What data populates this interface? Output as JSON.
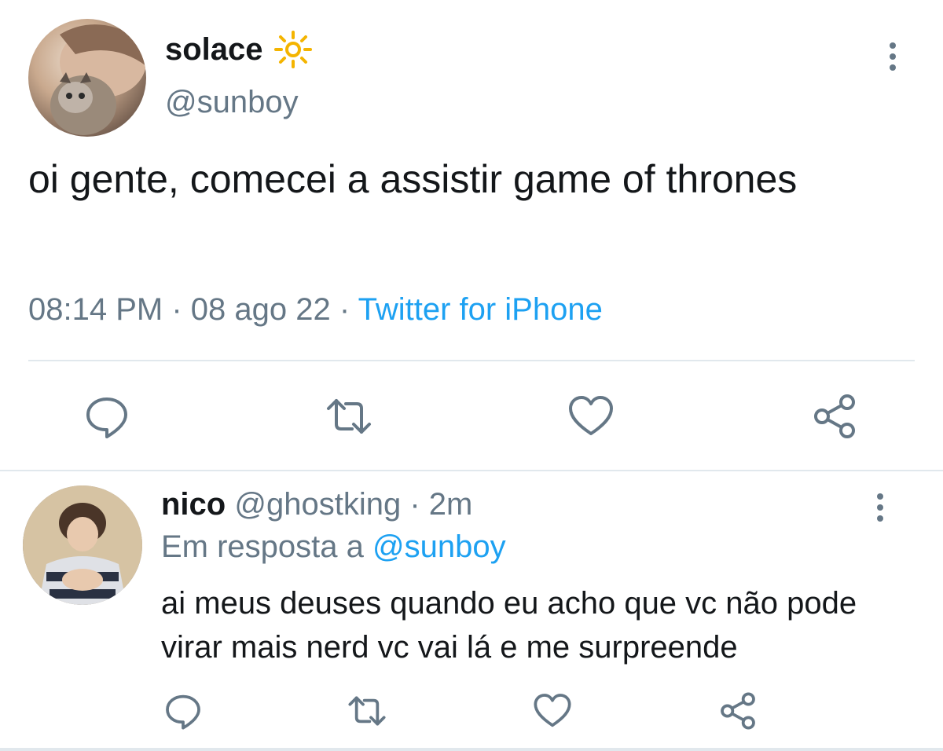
{
  "main_tweet": {
    "display_name": "solace",
    "name_emoji_icon": "sun-icon",
    "handle": "@sunboy",
    "text": "oi gente, comecei a assistir game of thrones",
    "time": "08:14 PM",
    "sep1": "·",
    "date": "08 ago 22",
    "sep2": "·",
    "client": "Twitter for iPhone",
    "actions": [
      "reply-icon",
      "retweet-icon",
      "like-icon",
      "share-icon"
    ]
  },
  "reply": {
    "display_name": "nico",
    "handle": "@ghostking",
    "sep": "·",
    "time": "2m",
    "reply_prefix": "Em resposta a",
    "reply_mention": "@sunboy",
    "text": "ai meus deuses quando eu acho que vc não pode virar mais nerd vc vai lá e me surpreende",
    "actions": [
      "reply-icon",
      "retweet-icon",
      "like-icon",
      "share-icon"
    ]
  },
  "colors": {
    "text": "#14171a",
    "muted": "#657786",
    "link": "#1da1f2",
    "divider": "#e1e8ed",
    "icon": "#657786",
    "sun": "#f4b400"
  }
}
